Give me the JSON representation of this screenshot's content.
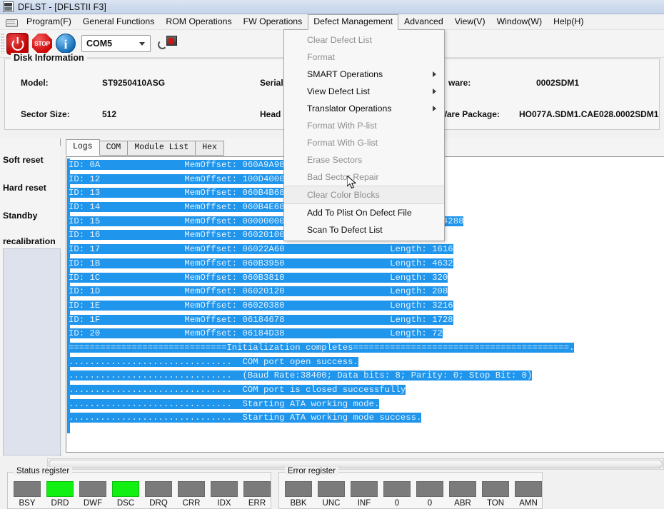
{
  "window": {
    "title": "DFLST - [DFLSTII  F3]",
    "icon": "app-icon"
  },
  "menubar": {
    "doc_icon": "document-icon",
    "items": [
      {
        "label": "Program(F)",
        "open": false
      },
      {
        "label": "General Functions",
        "open": false
      },
      {
        "label": "ROM Operations",
        "open": false
      },
      {
        "label": "FW Operations",
        "open": false
      },
      {
        "label": "Defect Management",
        "open": true
      },
      {
        "label": "Advanced",
        "open": false
      },
      {
        "label": "View(V)",
        "open": false
      },
      {
        "label": "Window(W)",
        "open": false
      },
      {
        "label": "Help(H)",
        "open": false
      }
    ]
  },
  "toolbar": {
    "power_icon": "power-icon",
    "stop_icon": "stop-icon",
    "stop_label": "STOP",
    "info_icon": "info-icon",
    "port_value": "COM5",
    "port_caret": "chevron-down-icon",
    "plug_icon": "serial-plug-icon"
  },
  "dropdown": {
    "owner": "Defect Management",
    "items": [
      {
        "label": "Clear Defect List",
        "disabled": true,
        "submenu": false,
        "hover": false
      },
      {
        "label": "Format",
        "disabled": true,
        "submenu": false,
        "hover": false
      },
      {
        "label": "SMART Operations",
        "disabled": false,
        "submenu": true,
        "hover": false
      },
      {
        "label": "View Defect List",
        "disabled": false,
        "submenu": true,
        "hover": false
      },
      {
        "label": "Translator Operations",
        "disabled": false,
        "submenu": true,
        "hover": false
      },
      {
        "label": "Format With P-list",
        "disabled": true,
        "submenu": false,
        "hover": false
      },
      {
        "label": "Format With G-list",
        "disabled": true,
        "submenu": false,
        "hover": false
      },
      {
        "label": "Erase Sectors",
        "disabled": true,
        "submenu": false,
        "hover": false
      },
      {
        "label": "Bad Sector Repair",
        "disabled": true,
        "submenu": false,
        "hover": false
      },
      {
        "label": "Clear Color Blocks",
        "disabled": true,
        "submenu": false,
        "hover": true
      },
      {
        "label": "Add To Plist On Defect File",
        "disabled": false,
        "submenu": false,
        "hover": false
      },
      {
        "label": "Scan To Defect List",
        "disabled": false,
        "submenu": false,
        "hover": false
      }
    ]
  },
  "disk_information": {
    "legend": "Disk Information",
    "model_label": "Model:",
    "model_value": "ST9250410ASG",
    "sector_size_label": "Sector Size:",
    "sector_size_value": "512",
    "serial_label": "Serial",
    "head_label": "Head",
    "firmware_label": "ware:",
    "firmware_value": "0002SDM1",
    "fw_package_label": "Ware Package:",
    "fw_package_value": "HO077A.SDM1.CAE028.0002SDM1"
  },
  "sidebar": {
    "buttons": [
      {
        "label": "Soft reset"
      },
      {
        "label": "Hard reset"
      },
      {
        "label": "Standby"
      },
      {
        "label": "recalibration"
      }
    ]
  },
  "tabs": [
    {
      "label": "Logs",
      "active": true
    },
    {
      "label": "COM",
      "active": false
    },
    {
      "label": "Module List",
      "active": false
    },
    {
      "label": "Hex",
      "active": false
    }
  ],
  "log": {
    "selection_color": "#1f95ec",
    "text_color": "#e3f2ff",
    "lines": [
      "ID: 0A                MemOffset: 060A9A98",
      "ID: 12                MemOffset: 100D4000",
      "ID: 13                MemOffset: 060B4B68",
      "ID: 14                MemOffset: 060B4E68",
      "ID: 15                MemOffset: 00000000                    Length: 524288",
      "ID: 16                MemOffset: 06020100                    Length: 32",
      "ID: 17                MemOffset: 06022A60                    Length: 1616",
      "ID: 1B                MemOffset: 060B3950                    Length: 4632",
      "ID: 1C                MemOffset: 060B3810                    Length: 320",
      "ID: 1D                MemOffset: 06020120                    Length: 208",
      "ID: 1E                MemOffset: 06020380                    Length: 3216",
      "ID: 1F                MemOffset: 06184678                    Length: 1728",
      "ID: 20                MemOffset: 06184D38                    Length: 72",
      "==============================Initialization completes=========================================.",
      "...............................  COM port open success.",
      "...............................  (Baud Rate:38400; Data bits: 8; Parity: 0; Stop Bit: 0)",
      "...............................  COM port is closed successfully",
      "...............................  Starting ATA working mode.",
      "...............................  Starting ATA working mode success."
    ]
  },
  "status_register": {
    "legend": "Status register",
    "leds": [
      {
        "name": "BSY",
        "on": false
      },
      {
        "name": "DRD",
        "on": true
      },
      {
        "name": "DWF",
        "on": false
      },
      {
        "name": "DSC",
        "on": true
      },
      {
        "name": "DRQ",
        "on": false
      },
      {
        "name": "CRR",
        "on": false
      },
      {
        "name": "IDX",
        "on": false
      },
      {
        "name": "ERR",
        "on": false
      }
    ]
  },
  "error_register": {
    "legend": "Error register",
    "leds": [
      {
        "name": "BBK",
        "on": false
      },
      {
        "name": "UNC",
        "on": false
      },
      {
        "name": "INF",
        "on": false
      },
      {
        "name": "0",
        "on": false
      },
      {
        "name": "0",
        "on": false
      },
      {
        "name": "ABR",
        "on": false
      },
      {
        "name": "TON",
        "on": false
      },
      {
        "name": "AMN",
        "on": false
      }
    ]
  }
}
